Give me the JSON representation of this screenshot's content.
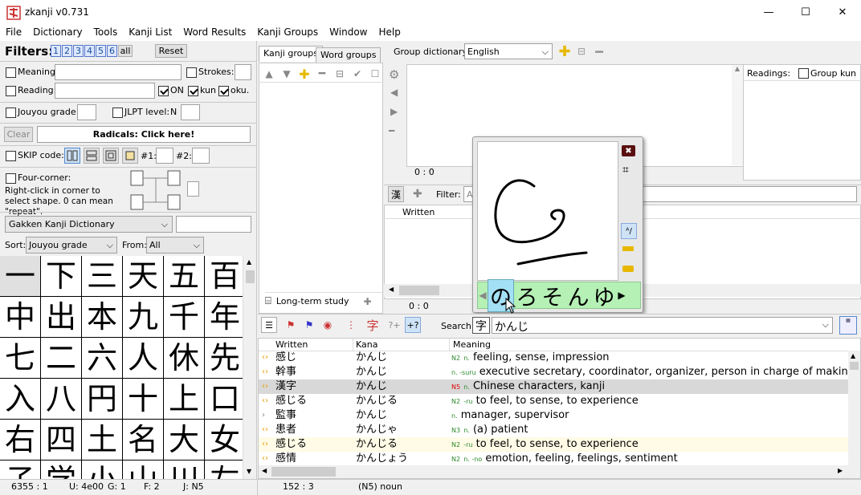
{
  "window": {
    "title": "zkanji v0.731",
    "minimize": "—",
    "maximize": "☐",
    "close": "✕"
  },
  "menu": [
    "File",
    "Dictionary",
    "Tools",
    "Kanji List",
    "Word Results",
    "Kanji Groups",
    "Window",
    "Help"
  ],
  "filters": {
    "label": "Filters:",
    "presets": [
      "1",
      "2",
      "3",
      "4",
      "5",
      "6",
      "all"
    ],
    "reset": "Reset",
    "meaning": "Meaning:",
    "strokes": "Strokes:",
    "reading": "Reading:",
    "on": "ON",
    "kun": "kun",
    "oku": "oku.",
    "jouyou": "Jouyou grade:",
    "jlpt": "JLPT level:",
    "jlpt_prefix": "N",
    "clear": "Clear",
    "radicals": "Radicals: Click here!",
    "skip": "SKIP code:",
    "skip1": "#1:",
    "skip2": "#2:",
    "four_corner": "Four-corner:",
    "four_corner_help": "Right-click in corner to select shape. 0 can mean \"repeat\".",
    "dict_select": "Gakken Kanji Dictionary",
    "sort_label": "Sort:",
    "sort_value": "Jouyou grade",
    "from_label": "From:",
    "from_value": "All"
  },
  "kanji_list": [
    "一",
    "下",
    "三",
    "天",
    "五",
    "百",
    "中",
    "出",
    "本",
    "九",
    "千",
    "年",
    "七",
    "二",
    "六",
    "人",
    "休",
    "先",
    "入",
    "八",
    "円",
    "十",
    "上",
    "口",
    "右",
    "四",
    "土",
    "名",
    "大",
    "女",
    "子",
    "学",
    "小",
    "山",
    "川",
    "左"
  ],
  "kanji_status": {
    "count": "6355 : 1",
    "unicode": "U: 4e00",
    "grade": "G: 1",
    "freq": "F: 2",
    "jlpt": "J: N5"
  },
  "groups": {
    "tab_kanji": "Kanji groups",
    "tab_word": "Word groups",
    "dict_label": "Group dictionary:",
    "dict_value": "English",
    "readings": "Readings:",
    "group_kun": "Group kun",
    "counter1": "0 : 0",
    "counter2": "0 : 0",
    "long_term": "Long-term study",
    "filter_label": "Filter:",
    "filter_value": "A",
    "written_col": "Written"
  },
  "handwriting": {
    "candidates": [
      "の",
      "ろ",
      "そ",
      "ん",
      "ゆ"
    ]
  },
  "dictionary": {
    "search_label": "Search:",
    "search_value": "かんじ",
    "columns": [
      "Written",
      "Kana",
      "Meaning"
    ],
    "rows": [
      {
        "written": "感じ",
        "kana": "かんじ",
        "jlpt": "N2",
        "pos": "n.",
        "meaning": "feeling, sense, impression"
      },
      {
        "written": "幹事",
        "kana": "かんじ",
        "jlpt": "",
        "pos": "n. -suru",
        "meaning": "executive secretary, coordinator, organizer, person in charge of makin"
      },
      {
        "written": "漢字",
        "kana": "かんじ",
        "jlpt": "N5",
        "pos": "n.",
        "meaning": "Chinese characters, kanji"
      },
      {
        "written": "感じる",
        "kana": "かんじる",
        "jlpt": "N2",
        "pos": "-ru",
        "meaning": "to feel, to sense, to experience"
      },
      {
        "written": "監事",
        "kana": "かんじ",
        "jlpt": "",
        "pos": "n.",
        "meaning": "manager, supervisor"
      },
      {
        "written": "患者",
        "kana": "かんじゃ",
        "jlpt": "N3",
        "pos": "n.",
        "meaning": "(a) patient"
      },
      {
        "written": "感じる",
        "kana": "かんじる",
        "jlpt": "N2",
        "pos": "-ru",
        "meaning": "to feel, to sense, to experience"
      },
      {
        "written": "感情",
        "kana": "かんじょう",
        "jlpt": "N2",
        "pos": "n. -no",
        "meaning": "emotion, feeling, feelings, sentiment"
      }
    ],
    "status_pos": "152 : 3",
    "status_info": "(N5) noun"
  },
  "colors": {
    "accent": "#2a8a2a",
    "n5": "#d00000",
    "candidate_bg": "#b5f0b5",
    "selected_row": "#d8d8d8"
  }
}
